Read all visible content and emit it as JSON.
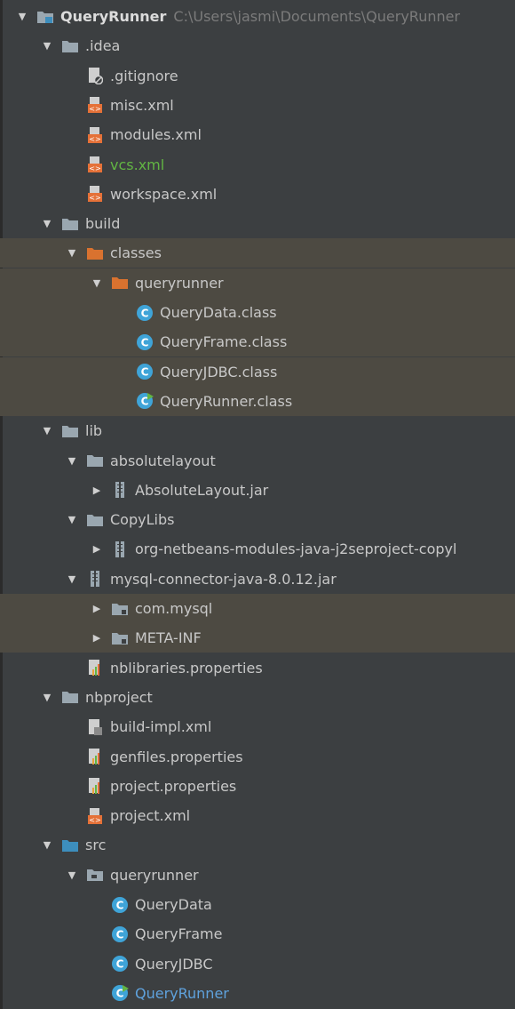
{
  "project_tree": {
    "root": {
      "label": "QueryRunner",
      "path": "C:\\Users\\jasmi\\Documents\\QueryRunner"
    },
    "items": [
      {
        "level": 1,
        "arrow": "down",
        "icon": "folder-icon",
        "label": "build"
      },
      {
        "level": 1,
        "arrow": "down",
        "icon": "folder-icon",
        "label": ".idea"
      }
    ],
    "rows": [
      {
        "id": "root",
        "level": 0,
        "arrow": "down",
        "icon": "module-folder-icon",
        "label": "QueryRunner",
        "path": "C:\\Users\\jasmi\\Documents\\QueryRunner"
      },
      {
        "id": "idea",
        "level": 1,
        "arrow": "down",
        "icon": "folder-icon",
        "label": ".idea"
      },
      {
        "id": "gitignore",
        "level": 2,
        "arrow": "none",
        "icon": "ignored-file-icon",
        "label": ".gitignore"
      },
      {
        "id": "misc-xml",
        "level": 2,
        "arrow": "none",
        "icon": "xml-file-icon",
        "label": "misc.xml"
      },
      {
        "id": "modules-xml",
        "level": 2,
        "arrow": "none",
        "icon": "xml-file-icon",
        "label": "modules.xml"
      },
      {
        "id": "vcs-xml",
        "level": 2,
        "arrow": "none",
        "icon": "xml-file-icon",
        "label": "vcs.xml",
        "color": "green"
      },
      {
        "id": "workspace-xml",
        "level": 2,
        "arrow": "none",
        "icon": "xml-file-icon",
        "label": "workspace.xml"
      },
      {
        "id": "build",
        "level": 1,
        "arrow": "down",
        "icon": "folder-icon",
        "label": "build"
      },
      {
        "id": "classes",
        "level": 2,
        "arrow": "down",
        "icon": "excluded-folder-icon",
        "label": "classes",
        "highlight": true
      },
      {
        "id": "queryrunner-classes",
        "level": 3,
        "arrow": "down",
        "icon": "excluded-folder-icon",
        "label": "queryrunner",
        "highlight": true
      },
      {
        "id": "querydata-class",
        "level": 4,
        "arrow": "none",
        "icon": "class-icon",
        "label": "QueryData.class",
        "highlight": true
      },
      {
        "id": "queryframe-class",
        "level": 4,
        "arrow": "none",
        "icon": "class-icon",
        "label": "QueryFrame.class",
        "highlight": true
      },
      {
        "id": "queryjdbc-class",
        "level": 4,
        "arrow": "none",
        "icon": "class-icon",
        "label": "QueryJDBC.class",
        "highlight": true
      },
      {
        "id": "queryrunner-class",
        "level": 4,
        "arrow": "none",
        "icon": "runnable-class-icon",
        "label": "QueryRunner.class",
        "highlight": true
      },
      {
        "id": "lib",
        "level": 1,
        "arrow": "down",
        "icon": "folder-icon",
        "label": "lib"
      },
      {
        "id": "absolutelayout",
        "level": 2,
        "arrow": "down",
        "icon": "folder-icon",
        "label": "absolutelayout"
      },
      {
        "id": "absolutelayout-jar",
        "level": 3,
        "arrow": "right",
        "icon": "jar-icon",
        "label": "AbsoluteLayout.jar"
      },
      {
        "id": "copylibs",
        "level": 2,
        "arrow": "down",
        "icon": "folder-icon",
        "label": "CopyLibs"
      },
      {
        "id": "copylibs-jar",
        "level": 3,
        "arrow": "right",
        "icon": "jar-icon",
        "label": "org-netbeans-modules-java-j2seproject-copyl"
      },
      {
        "id": "mysql-jar",
        "level": 2,
        "arrow": "down",
        "icon": "jar-icon",
        "label": "mysql-connector-java-8.0.12.jar"
      },
      {
        "id": "com-mysql",
        "level": 3,
        "arrow": "right",
        "icon": "package-folder-icon",
        "label": "com.mysql",
        "highlight": true
      },
      {
        "id": "meta-inf",
        "level": 3,
        "arrow": "right",
        "icon": "package-folder-icon",
        "label": "META-INF",
        "highlight": true
      },
      {
        "id": "nblibraries-properties",
        "level": 2,
        "arrow": "none",
        "icon": "properties-file-icon",
        "label": "nblibraries.properties"
      },
      {
        "id": "nbproject",
        "level": 1,
        "arrow": "down",
        "icon": "folder-icon",
        "label": "nbproject"
      },
      {
        "id": "build-impl-xml",
        "level": 2,
        "arrow": "none",
        "icon": "build-xml-icon",
        "label": "build-impl.xml"
      },
      {
        "id": "genfiles-properties",
        "level": 2,
        "arrow": "none",
        "icon": "properties-file-icon",
        "label": "genfiles.properties"
      },
      {
        "id": "project-properties",
        "level": 2,
        "arrow": "none",
        "icon": "properties-file-icon",
        "label": "project.properties"
      },
      {
        "id": "project-xml",
        "level": 2,
        "arrow": "none",
        "icon": "xml-file-icon",
        "label": "project.xml"
      },
      {
        "id": "src",
        "level": 1,
        "arrow": "down",
        "icon": "source-folder-icon",
        "label": "src"
      },
      {
        "id": "queryrunner-pkg",
        "level": 2,
        "arrow": "down",
        "icon": "package-icon",
        "label": "queryrunner"
      },
      {
        "id": "querydata",
        "level": 3,
        "arrow": "none",
        "icon": "class-icon",
        "label": "QueryData"
      },
      {
        "id": "queryframe",
        "level": 3,
        "arrow": "none",
        "icon": "class-icon",
        "label": "QueryFrame"
      },
      {
        "id": "queryjdbc",
        "level": 3,
        "arrow": "none",
        "icon": "class-icon",
        "label": "QueryJDBC"
      },
      {
        "id": "queryrunner",
        "level": 3,
        "arrow": "none",
        "icon": "runnable-class-icon",
        "label": "QueryRunner",
        "color": "blue"
      }
    ]
  },
  "colors": {
    "background": "#3c3f41",
    "highlight": "#4d4a42",
    "text": "#c8c8c8",
    "path_text": "#7b7b7b",
    "vcs_added": "#62b543",
    "vcs_modified": "#5fa2dd",
    "folder": "#9aa7b0",
    "excluded_folder": "#d9722f",
    "source_folder": "#3d8ebd",
    "class": "#3fa4d8",
    "xml_file": "#e57138"
  }
}
